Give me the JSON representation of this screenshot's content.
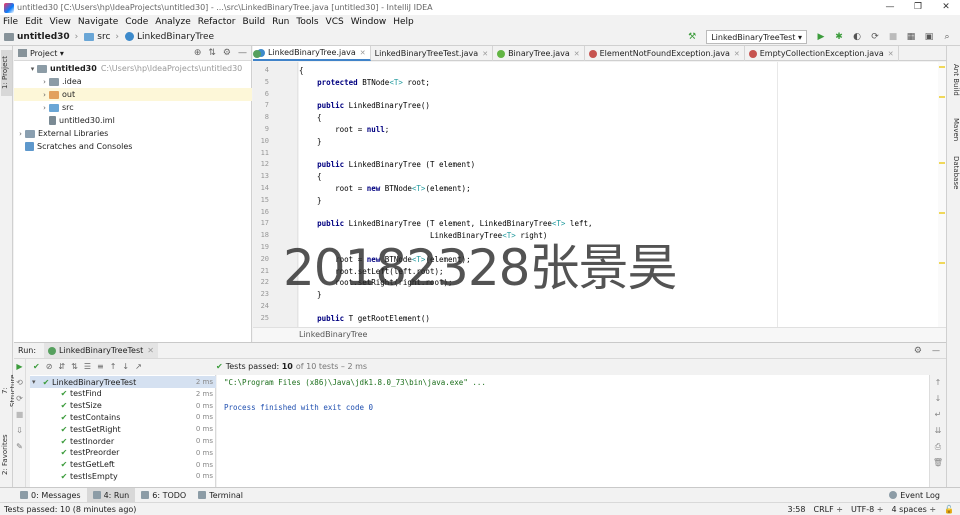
{
  "window": {
    "title": "untitled30 [C:\\Users\\hp\\IdeaProjects\\untitled30] - ...\\src\\LinkedBinaryTree.java [untitled30] - IntelliJ IDEA",
    "minimize": "—",
    "maximize": "❐",
    "close": "✕"
  },
  "menu": [
    "File",
    "Edit",
    "View",
    "Navigate",
    "Code",
    "Analyze",
    "Refactor",
    "Build",
    "Run",
    "Tools",
    "VCS",
    "Window",
    "Help"
  ],
  "nav": {
    "project": "untitled30",
    "folder": "src",
    "file": "LinkedBinaryTree",
    "run_config": "LinkedBinaryTreeTest"
  },
  "project_panel": {
    "title": "Project",
    "tree": [
      {
        "label": "untitled30",
        "path": "C:\\Users\\hp\\IdeaProjects\\untitled30",
        "icon": "gray",
        "indent": 1,
        "arrow": "▾",
        "bold": true
      },
      {
        "label": ".idea",
        "icon": "gray",
        "indent": 2,
        "arrow": "›"
      },
      {
        "label": "out",
        "icon": "orange",
        "indent": 2,
        "arrow": "›",
        "selected": true
      },
      {
        "label": "src",
        "icon": "blue",
        "indent": 2,
        "arrow": "›"
      },
      {
        "label": "untitled30.iml",
        "icon": "iml",
        "indent": 2,
        "arrow": ""
      },
      {
        "label": "External Libraries",
        "icon": "lib",
        "indent": 0,
        "arrow": "›"
      },
      {
        "label": "Scratches and Consoles",
        "icon": "scr",
        "indent": 0,
        "arrow": ""
      }
    ]
  },
  "left_strip": {
    "project": "1: Project",
    "structure": "7: Structure",
    "favorites": "2: Favorites"
  },
  "right_strip": {
    "ant": "Ant Build",
    "maven": "Maven",
    "database": "Database"
  },
  "editor_tabs": [
    {
      "label": "LinkedBinaryTree.java",
      "kind": "class",
      "active": true
    },
    {
      "label": "LinkedBinaryTreeTest.java",
      "kind": "test"
    },
    {
      "label": "BinaryTree.java",
      "kind": "iface"
    },
    {
      "label": "ElementNotFoundException.java",
      "kind": "exc"
    },
    {
      "label": "EmptyCollectionException.java",
      "kind": "exc"
    }
  ],
  "code": {
    "lines": [
      {
        "n": "4",
        "text": "{"
      },
      {
        "n": "5",
        "text": "    protected BTNode<T> root;"
      },
      {
        "n": "6",
        "text": ""
      },
      {
        "n": "7",
        "text": "    public LinkedBinaryTree()"
      },
      {
        "n": "8",
        "text": "    {"
      },
      {
        "n": "9",
        "text": "        root = null;"
      },
      {
        "n": "10",
        "text": "    }"
      },
      {
        "n": "11",
        "text": ""
      },
      {
        "n": "12",
        "text": "    public LinkedBinaryTree (T element)"
      },
      {
        "n": "13",
        "text": "    {"
      },
      {
        "n": "14",
        "text": "        root = new BTNode<T>(element);"
      },
      {
        "n": "15",
        "text": "    }"
      },
      {
        "n": "16",
        "text": ""
      },
      {
        "n": "17",
        "text": "    public LinkedBinaryTree (T element, LinkedBinaryTree<T> left,"
      },
      {
        "n": "18",
        "text": "                             LinkedBinaryTree<T> right)"
      },
      {
        "n": "19",
        "text": ""
      },
      {
        "n": "20",
        "text": "        root = new BTNode<T>(element);"
      },
      {
        "n": "21",
        "text": "        root.setLeft(left.root);"
      },
      {
        "n": "22",
        "text": "        root.setRight(right.root);"
      },
      {
        "n": "23",
        "text": "    }"
      },
      {
        "n": "24",
        "text": ""
      },
      {
        "n": "25",
        "text": "    public T getRootElement()"
      }
    ],
    "breadcrumb": "LinkedBinaryTree"
  },
  "watermark": "20182328张景昊",
  "run": {
    "label": "Run:",
    "tab": "LinkedBinaryTreeTest",
    "status_prefix": "Tests passed:",
    "passed": "10",
    "status_suffix": "of 10 tests – 2 ms",
    "tests": [
      {
        "name": "LinkedBinaryTreeTest",
        "time": "2 ms",
        "root": true
      },
      {
        "name": "testFind",
        "time": "2 ms"
      },
      {
        "name": "testSize",
        "time": "0 ms"
      },
      {
        "name": "testContains",
        "time": "0 ms"
      },
      {
        "name": "testGetRight",
        "time": "0 ms"
      },
      {
        "name": "testInorder",
        "time": "0 ms"
      },
      {
        "name": "testPreorder",
        "time": "0 ms"
      },
      {
        "name": "testGetLeft",
        "time": "0 ms"
      },
      {
        "name": "testIsEmpty",
        "time": "0 ms"
      }
    ],
    "console": [
      "\"C:\\Program Files (x86)\\Java\\jdk1.8.0_73\\bin\\java.exe\" ...",
      "",
      "Process finished with exit code 0"
    ]
  },
  "toolwindows": [
    {
      "label": "0: Messages"
    },
    {
      "label": "4: Run",
      "active": true
    },
    {
      "label": "6: TODO"
    },
    {
      "label": "Terminal"
    }
  ],
  "event_log": "Event Log",
  "status": {
    "message": "Tests passed: 10 (8 minutes ago)",
    "position": "3:58",
    "line_sep": "CRLF ÷",
    "encoding": "UTF-8 ÷",
    "indent": "4 spaces ÷"
  }
}
